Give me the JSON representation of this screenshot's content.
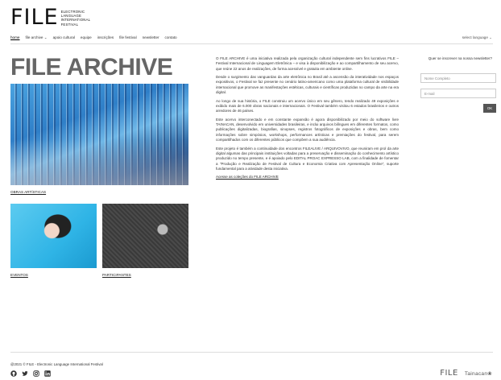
{
  "header": {
    "logo_text": "FILE",
    "logo_sub": [
      "ELECTRONIC",
      "LANGUAGE",
      "INTERNATIONAL",
      "FESTIVAL"
    ],
    "nav": [
      {
        "label": "home",
        "active": true
      },
      {
        "label": "file archive ⌄",
        "active": false
      },
      {
        "label": "apoio cultural",
        "active": false
      },
      {
        "label": "equipe",
        "active": false
      },
      {
        "label": "inscrições",
        "active": false
      },
      {
        "label": "file festival",
        "active": false
      },
      {
        "label": "newsletter",
        "active": false
      },
      {
        "label": "contato",
        "active": false
      }
    ],
    "language_select": "select language ⌄"
  },
  "main": {
    "title": "FILE ARCHIVE",
    "captions": {
      "obras": "OBRAS ARTÍSTICAS",
      "eventos": "EVENTOS",
      "participantes": "PARTICIPANTES"
    },
    "paragraphs": [
      "O FILE ARCHIVE é uma iniciativa realizada pela organização cultural independente sem fins lucrativos FILE – Festival Internacional de Linguagem Eletrônica – e visa à disponibilização e ao compartilhamento de seu acervo, que reúne 22 anos de realizações, de forma acessível e gratuita em ambiente online.",
      "Desde o surgimento das vanguardas da arte eletrônica no Brasil até a ascensão da interatividade nos espaços expositivos, o Festival se faz presente no cenário latino-americano como uma plataforma cultural de visibilidade internacional que promove as manifestações estéticas, culturais e científicas produzidas no campo da arte na era digital.",
      "Ao longo de sua história, o FILE construiu um acervo único em seu gênero, tendo realizado 49 exposições e exibido mais de 6.000 obras nacionais e internacionais. O Festival também visitou 6 estados brasileiros e outros arredores de 46 países.",
      "Este acervo interconectado e em constante expansão é agora disponibilizado por meio do software livre TAINACAN, desenvolvido em universidades brasileiras, e inclui arquivos bilíngues em diferentes formatos, como publicações digitalizadas, biografias, sinopses, registros fotográficos de exposições e obras, bem como informações sobre simpósios, workshops, performances artísticas e premiações do festival, para serem compartilhados com os diferentes públicos que compõem a sua audiência.",
      "Este projeto é também a continuidade dos encontros FILEALIVE / ARQUIVOVIVO, que reuniram em prol da arte digital algumas das principais instituições voltadas para a preservação e disseminação do conhecimento artístico produzido no tempo presente, e é apoiado pelo EDITAL PROAC EXPRESSO LAB, com a finalidade de fomentar a \"Produção e Realização de Festival de Cultura e Economia Criativa com Apresentação Online\", suporte fundamental para a atividade desta iniciativa."
    ],
    "collections_link": "Acesse as coleções do FILE ARCHIVE"
  },
  "newsletter": {
    "question": "Quer se inscrever na nossa newsletter?",
    "name_placeholder": "Nome Completo",
    "email_placeholder": "E-mail",
    "ok_label": "OK"
  },
  "footer": {
    "copyright": "@2021 © FILE - Electronic Language International Festival",
    "social_icons": [
      "github-icon",
      "twitter-icon",
      "instagram-icon",
      "linkedin-icon"
    ],
    "logo_file": "FILE",
    "logo_tainacan": "Tainacan"
  }
}
